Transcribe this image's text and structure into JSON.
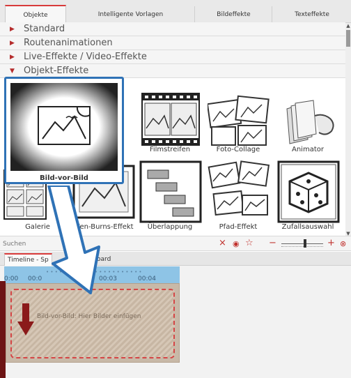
{
  "tabs": [
    {
      "label": "Objekte",
      "active": true
    },
    {
      "label": "Intelligente Vorlagen",
      "active": false
    },
    {
      "label": "Bildeffekte",
      "active": false
    },
    {
      "label": "Texteffekte",
      "active": false
    }
  ],
  "categories": [
    {
      "label": "Standard",
      "expanded": false
    },
    {
      "label": "Routenanimationen",
      "expanded": false
    },
    {
      "label": "Live-Effekte / Video-Effekte",
      "expanded": false
    },
    {
      "label": "Objekt-Effekte",
      "expanded": true
    }
  ],
  "effects": {
    "filmstreifen": "Filmstreifen",
    "fotocollage": "Foto-Collage",
    "animator": "Animator",
    "galerie": "Galerie",
    "kenburns": "Ken-Burns-Effekt",
    "ueberlappung": "Überlappung",
    "pfad": "Pfad-Effekt",
    "zufall": "Zufallsauswahl"
  },
  "highlight": {
    "label": "Bild-vor-Bild"
  },
  "search": {
    "placeholder": "Suchen"
  },
  "timeline": {
    "tab_active": "Timeline - Sp",
    "tab_storyboard": "yboard",
    "ticks": [
      "0:00",
      "00:0",
      "00:03",
      "00:04"
    ],
    "clip_text": "Bild-vor-Bild: Hier Bilder einfügen"
  },
  "colors": {
    "accent_red": "#d83a3a",
    "callout_blue": "#2f72b6",
    "ruler_blue": "#8ec4e6",
    "clip_brown": "#c8b9a8",
    "drop_arrow": "#8b1a1a"
  }
}
